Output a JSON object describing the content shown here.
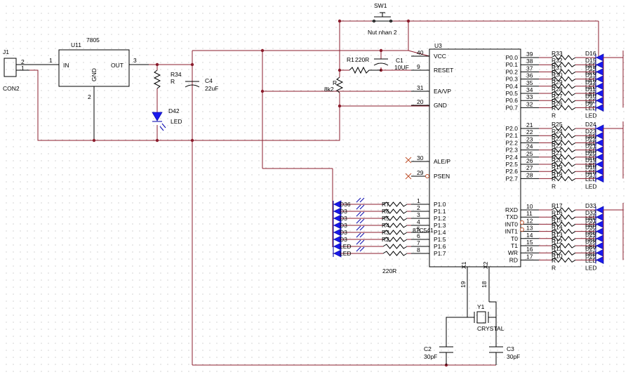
{
  "j1": {
    "ref": "J1",
    "name": "CON2",
    "pin2": "2",
    "pin1": "1"
  },
  "u11": {
    "ref": "U11",
    "value": "7805",
    "in": "IN",
    "out": "OUT",
    "gnd": "GND",
    "pin_in": "1",
    "pin_gnd": "2",
    "pin_out": "3"
  },
  "r34": {
    "ref": "R34",
    "value": "R"
  },
  "c4": {
    "ref": "C4",
    "value": "22uF"
  },
  "d42": {
    "ref": "D42",
    "value": "LED"
  },
  "sw1": {
    "ref": "SW1",
    "value": "Nut nhan 2"
  },
  "r1": {
    "ref": "R1",
    "value": "220R"
  },
  "c1": {
    "ref": "C1",
    "value": "10UF"
  },
  "rpot": {
    "ref": "R",
    "value": "8k2"
  },
  "u3": {
    "ref": "U3",
    "part": "87C541",
    "left_pins": [
      {
        "num": "40",
        "name": "VCC"
      },
      {
        "num": "9",
        "name": "RESET"
      },
      {
        "num": "31",
        "name": "EA/VP"
      },
      {
        "num": "20",
        "name": "GND"
      },
      {
        "num": "30",
        "name": "ALE/P"
      },
      {
        "num": "29",
        "name": "PSEN"
      },
      {
        "num": "1",
        "name": "P1.0"
      },
      {
        "num": "2",
        "name": "P1.1"
      },
      {
        "num": "3",
        "name": "P1.2"
      },
      {
        "num": "4",
        "name": "P1.3"
      },
      {
        "num": "5",
        "name": "P1.4"
      },
      {
        "num": "6",
        "name": "P1.5"
      },
      {
        "num": "7",
        "name": "P1.6"
      },
      {
        "num": "8",
        "name": "P1.7"
      }
    ],
    "right_pins": [
      {
        "num": "39",
        "name": "P0.0"
      },
      {
        "num": "38",
        "name": "P0.1"
      },
      {
        "num": "37",
        "name": "P0.2"
      },
      {
        "num": "36",
        "name": "P0.3"
      },
      {
        "num": "35",
        "name": "P0.4"
      },
      {
        "num": "34",
        "name": "P0.5"
      },
      {
        "num": "33",
        "name": "P0.6"
      },
      {
        "num": "32",
        "name": "P0.7"
      },
      {
        "num": "21",
        "name": "P2.0"
      },
      {
        "num": "22",
        "name": "P2.1"
      },
      {
        "num": "23",
        "name": "P2.2"
      },
      {
        "num": "24",
        "name": "P2.3"
      },
      {
        "num": "25",
        "name": "P2.4"
      },
      {
        "num": "26",
        "name": "P2.5"
      },
      {
        "num": "27",
        "name": "P2.6"
      },
      {
        "num": "28",
        "name": "P2.7"
      },
      {
        "num": "10",
        "name": "RXD"
      },
      {
        "num": "11",
        "name": "TXD"
      },
      {
        "num": "12",
        "name": "INT0"
      },
      {
        "num": "13",
        "name": "INT1"
      },
      {
        "num": "14",
        "name": "T0"
      },
      {
        "num": "15",
        "name": "T1"
      },
      {
        "num": "16",
        "name": "WR"
      },
      {
        "num": "17",
        "name": "RD"
      }
    ],
    "bottom_pins": [
      {
        "num": "19",
        "name": "X1"
      },
      {
        "num": "18",
        "name": "X2"
      }
    ]
  },
  "y1": {
    "ref": "Y1",
    "value": "CRYSTAL"
  },
  "c2": {
    "ref": "C2",
    "value": "30pF"
  },
  "c3": {
    "ref": "C3",
    "value": "30pF"
  },
  "p1_bank": {
    "res_refs": [
      "R7",
      "R6",
      "R5",
      "R4",
      "R3",
      "R2"
    ],
    "led_refs": [
      "D36",
      "D3",
      "D3",
      "D3",
      "D3",
      "D3"
    ],
    "led_label": "LED",
    "res_value": "220R"
  },
  "bank0": {
    "res_refs": [
      "R33",
      "R32",
      "R31",
      "R30",
      "R29",
      "R28",
      "R27",
      "R26"
    ],
    "led_refs": [
      "D16",
      "D15",
      "D14",
      "D13",
      "D12",
      "D11",
      "D10",
      "D9"
    ],
    "res_value": "R",
    "led_value": "LED"
  },
  "bank2": {
    "res_refs": [
      "R25",
      "R24",
      "R23",
      "R22",
      "R21",
      "R20",
      "R19",
      "R18"
    ],
    "led_refs": [
      "D24",
      "D23",
      "D22",
      "D21",
      "D20",
      "D19",
      "D18",
      "D17"
    ],
    "res_value": "R",
    "led_value": "LED"
  },
  "bank3": {
    "res_refs": [
      "R17",
      "R16",
      "R15",
      "R14",
      "R13",
      "R12",
      "R11",
      "R10"
    ],
    "led_refs": [
      "D33",
      "D32",
      "D31",
      "D30",
      "D29",
      "D28",
      "D27",
      "D26"
    ],
    "res_value": "R",
    "led_value": "LED"
  }
}
